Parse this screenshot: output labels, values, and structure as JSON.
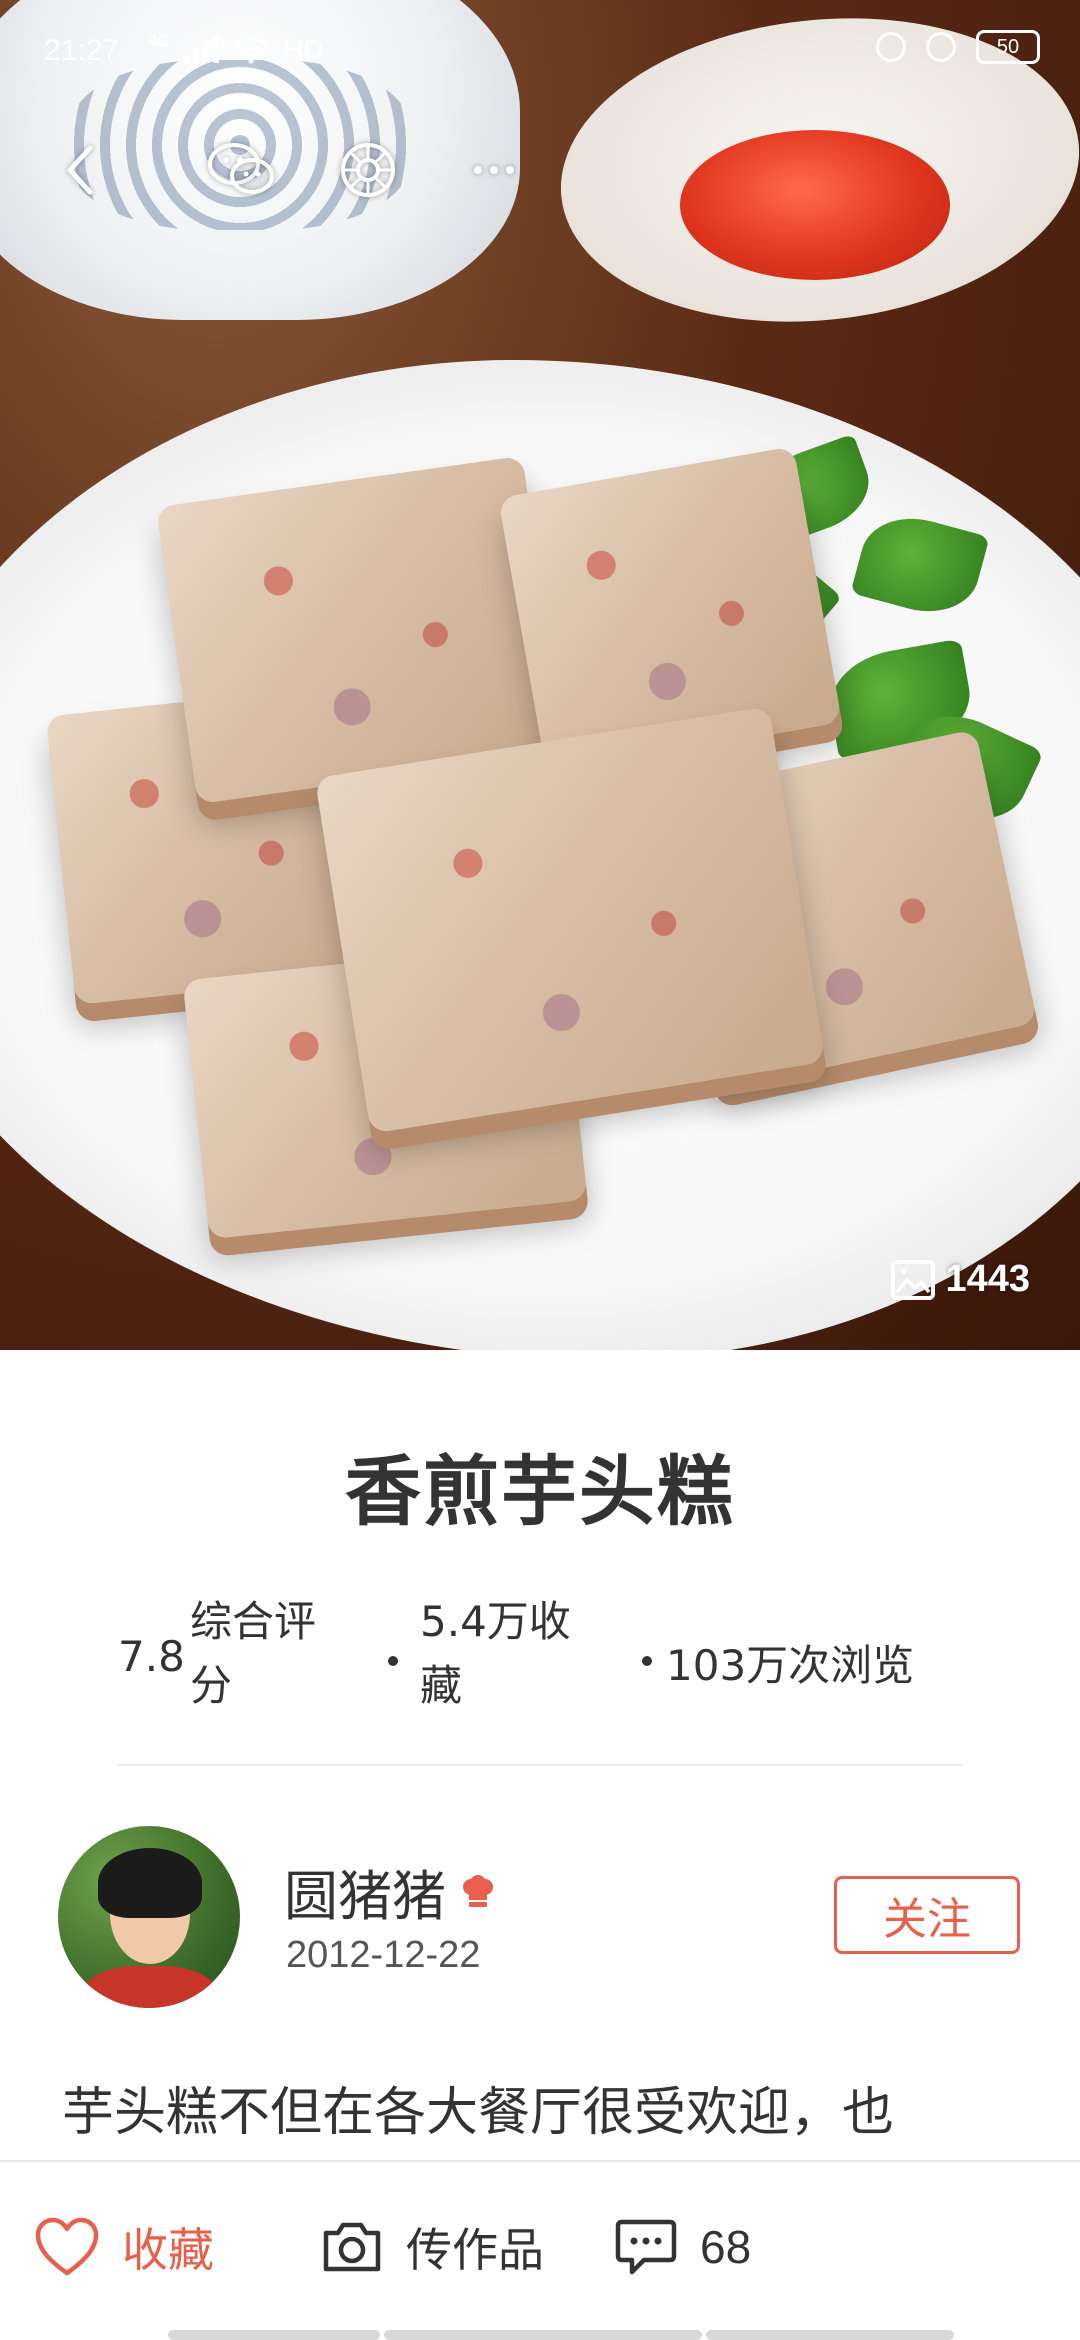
{
  "status_bar": {
    "time": "21:27",
    "network": "4G",
    "connection": "HD",
    "battery": "50"
  },
  "toolbar": {
    "icons": [
      "back-icon",
      "wechat-icon",
      "moments-icon",
      "more-icon"
    ]
  },
  "hero": {
    "photo_count": "1443"
  },
  "recipe": {
    "title": "香煎芋头糕",
    "score_value": "7.8",
    "score_label": "综合评分",
    "favorites": "5.4万收藏",
    "views": "103万次浏览"
  },
  "author": {
    "name": "圆猪猪",
    "date": "2012-12-22",
    "follow_label": "关注"
  },
  "description": "芋头糕不但在各大餐厅很受欢迎，也",
  "bottom_bar": {
    "favorite_label": "收藏",
    "upload_label": "传作品",
    "comment_count": "68"
  },
  "colors": {
    "accent": "#e8604c",
    "text": "#333333"
  }
}
